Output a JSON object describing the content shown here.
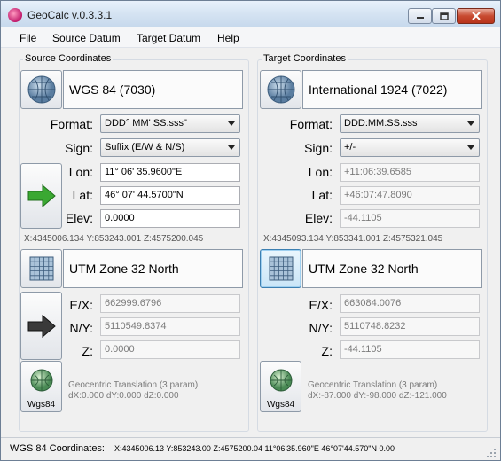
{
  "window": {
    "title": "GeoCalc v.0.3.3.1"
  },
  "menu": [
    "File",
    "Source Datum",
    "Target Datum",
    "Help"
  ],
  "source": {
    "group_title": "Source Coordinates",
    "datum": "WGS 84 (7030)",
    "format_label": "Format:",
    "format_value": "DDD° MM' SS.sss\"",
    "sign_label": "Sign:",
    "sign_value": "Suffix (E/W & N/S)",
    "lon_label": "Lon:",
    "lon_value": "11° 06' 35.9600\"E",
    "lat_label": "Lat:",
    "lat_value": "46° 07' 44.5700\"N",
    "elev_label": "Elev:",
    "elev_value": "0.0000",
    "ecef": "X:4345006.134 Y:853243.001 Z:4575200.045",
    "projection": "UTM Zone 32 North",
    "e_label": "E/X:",
    "e_value": "662999.6796",
    "n_label": "N/Y:",
    "n_value": "5110549.8374",
    "z_label": "Z:",
    "z_value": "0.0000",
    "transform_caption": "Wgs84",
    "transform_note1": "Geocentric Translation (3 param)",
    "transform_note2": "dX:0.000 dY:0.000 dZ:0.000"
  },
  "target": {
    "group_title": "Target Coordinates",
    "datum": "International 1924 (7022)",
    "format_label": "Format:",
    "format_value": "DDD:MM:SS.sss",
    "sign_label": "Sign:",
    "sign_value": "+/-",
    "lon_label": "Lon:",
    "lon_value": "+11:06:39.6585",
    "lat_label": "Lat:",
    "lat_value": "+46:07:47.8090",
    "elev_label": "Elev:",
    "elev_value": "-44.1105",
    "ecef": "X:4345093.134 Y:853341.001 Z:4575321.045",
    "projection": "UTM Zone 32 North",
    "e_label": "E/X:",
    "e_value": "663084.0076",
    "n_label": "N/Y:",
    "n_value": "5110748.8232",
    "z_label": "Z:",
    "z_value": "-44.1105",
    "transform_caption": "Wgs84",
    "transform_note1": "Geocentric Translation (3 param)",
    "transform_note2": "dX:-87.000 dY:-98.000 dZ:-121.000"
  },
  "status": {
    "label": "WGS 84 Coordinates:",
    "value": "X:4345006.13 Y:853243.00 Z:4575200.04  11°06'35.960\"E 46°07'44.570\"N 0.00"
  },
  "colors": {
    "arrow_green": "#3aa832",
    "arrow_dark": "#3a3a3a",
    "title_bar": "#d6e4f3"
  }
}
